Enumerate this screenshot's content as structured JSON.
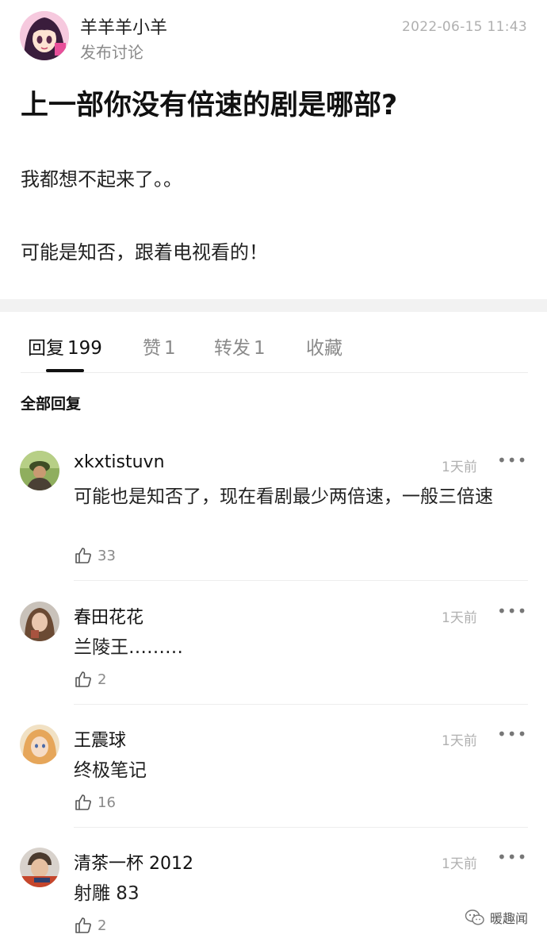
{
  "post": {
    "author": "羊羊羊小羊",
    "action": "发布讨论",
    "time": "2022-06-15 11:43",
    "title": "上一部你没有倍速的剧是哪部?",
    "body": [
      "我都想不起来了。。",
      "可能是知否，跟着电视看的！"
    ]
  },
  "tabs": [
    {
      "label": "回复",
      "count": "199"
    },
    {
      "label": "赞",
      "count": "1"
    },
    {
      "label": "转发",
      "count": "1"
    },
    {
      "label": "收藏",
      "count": ""
    }
  ],
  "section_label": "全部回复",
  "comments": [
    {
      "name": "xkxtistuvn",
      "time": "1天前",
      "more": "•••",
      "text": "可能也是知否了，现在看剧最少两倍速，一般三倍速",
      "likes": "33"
    },
    {
      "name": "春田花花",
      "time": "1天前",
      "more": "•••",
      "text": "兰陵王………",
      "likes": "2"
    },
    {
      "name": "王震球",
      "time": "1天前",
      "more": "•••",
      "text": "终极笔记",
      "likes": "16"
    },
    {
      "name": "清茶一杯 2012",
      "time": "1天前",
      "more": "•••",
      "text": "射雕 83",
      "likes": "2"
    }
  ],
  "watermark": "暖趣闻",
  "icons": {
    "like": "thumbs-up-icon",
    "more": "more-dots-icon",
    "watermark": "wechat-icon"
  }
}
